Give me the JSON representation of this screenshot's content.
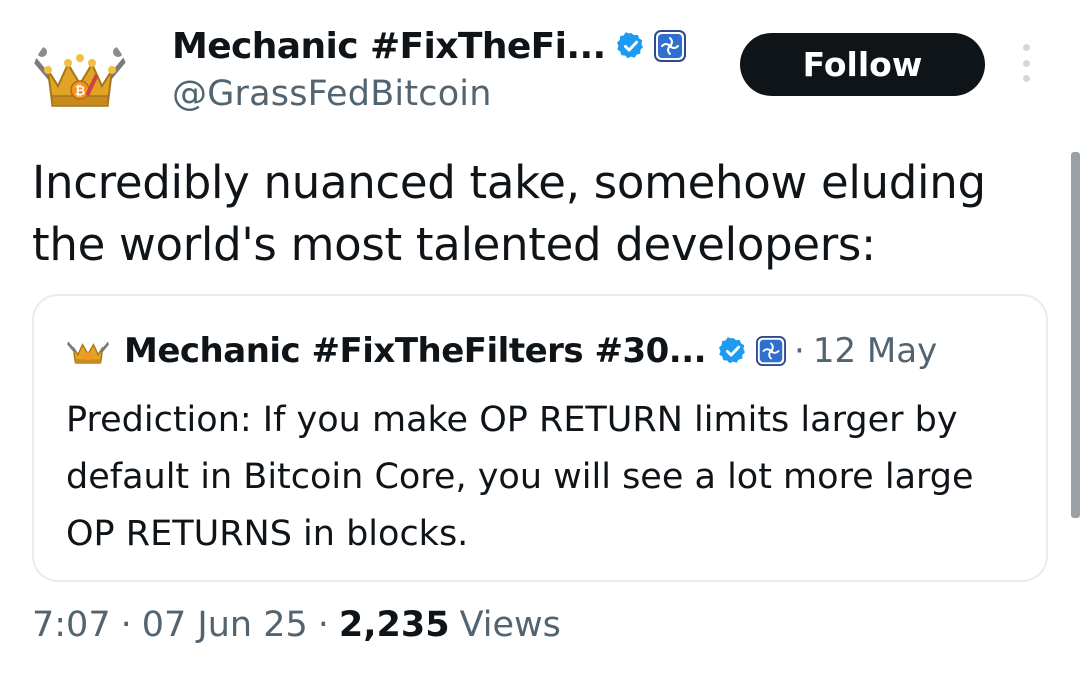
{
  "author": {
    "display_name": "Mechanic #FixTheFi...",
    "handle": "@GrassFedBitcoin",
    "avatar_text": "₿"
  },
  "follow_label": "Follow",
  "tweet_text": "Incredibly nuanced take, somehow eluding the world's most talented developers:",
  "quoted": {
    "display_name": "Mechanic #FixTheFilters #30...",
    "separator": "·",
    "date": "12 May",
    "text": "Prediction: If you make OP RETURN limits larger by default in Bitcoin Core, you will see a lot more large OP RETURNS in blocks."
  },
  "meta": {
    "time": "7:07",
    "date": "07 Jun 25",
    "separator": "·",
    "views_count": "2,235",
    "views_label": "Views"
  },
  "colors": {
    "verified_blue": "#1d9bf0",
    "secondary_text": "#536471",
    "border": "#e6ecf0",
    "crown_gold": "#e0a526",
    "bitcoin_orange": "#f7931a"
  },
  "icons": {
    "verified": "verified-badge-icon",
    "affiliate": "affiliate-badge-icon",
    "more": "more-options-icon"
  }
}
